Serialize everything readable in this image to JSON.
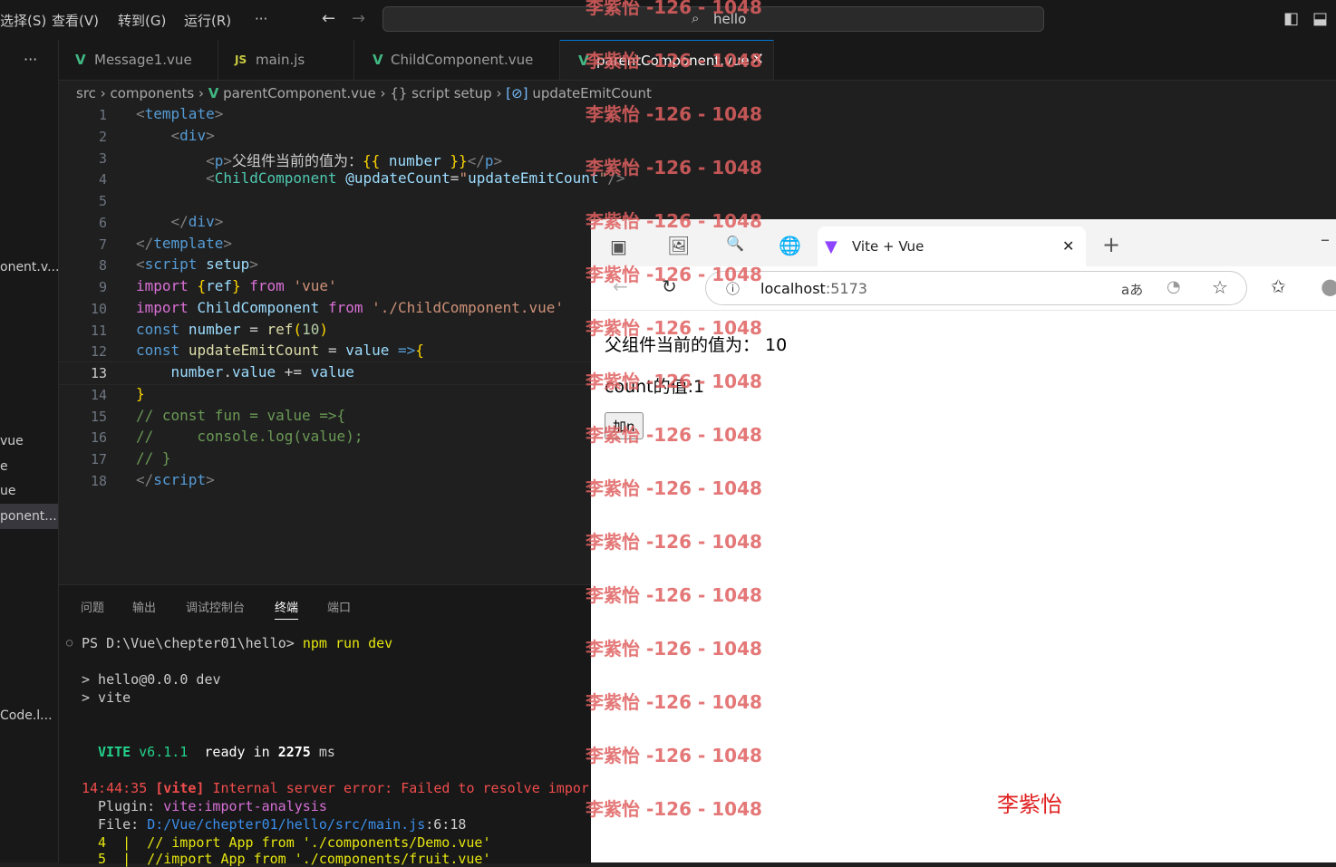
{
  "titlebar": {
    "menus": [
      "选择(S)",
      "查看(V)",
      "转到(G)",
      "运行(R)",
      "···"
    ],
    "search": "hello"
  },
  "sidebar": {
    "items": [
      "onent.v...",
      "vue",
      "e",
      "ue",
      "ponent....",
      "Code.l..."
    ]
  },
  "tabs": [
    {
      "label": "Message1.vue",
      "icon": "vue-icon"
    },
    {
      "label": "main.js",
      "icon": "js-icon"
    },
    {
      "label": "ChildComponent.vue",
      "icon": "vue-icon"
    },
    {
      "label": "parentComponent.vue",
      "icon": "vue-icon",
      "active": true
    }
  ],
  "breadcrumb": {
    "src": "src",
    "components": "components",
    "file": "parentComponent.vue",
    "script": "{} script setup",
    "symbol": "updateEmitCount"
  },
  "code": {
    "line_numbers": [
      "1",
      "2",
      "3",
      "4",
      "5",
      "6",
      "7",
      "8",
      "9",
      "10",
      "11",
      "12",
      "13",
      "14",
      "15",
      "16",
      "17",
      "18"
    ],
    "current_line": "13"
  },
  "panel": {
    "tabs": [
      "问题",
      "输出",
      "调试控制台",
      "终端",
      "端口"
    ],
    "active_tab": "终端",
    "terminal": {
      "prompt": "PS D:\\Vue\\chepter01\\hello>",
      "cmd": "npm run dev",
      "l1": "> hello@0.0.0 dev",
      "l2": "> vite",
      "vite": "VITE",
      "ver": "v6.1.1",
      "ready": "ready in",
      "ms_val": "2275",
      "ms": "ms",
      "time": "14:44:35",
      "vtag": "[vite]",
      "err": "Internal server error: Failed to resolve impor",
      "plugin_lbl": "Plugin:",
      "plugin": "vite:import-analysis",
      "file_lbl": "File:",
      "file": "D:/Vue/chepter01/hello/src/main.js",
      "file_pos": ":6:18",
      "c4": "4  |  // import App from './components/Demo.vue'",
      "c5": "5  |  //import App from './components/fruit.vue'"
    }
  },
  "browser": {
    "tab_title": "Vite + Vue",
    "url_host": "localhost",
    "url_port": ":5173",
    "read_aloud": "aあ",
    "page": {
      "p1": "父组件当前的值为：  10",
      "p2": "count的值:1",
      "button": "加n",
      "signature": "李紫怡"
    }
  },
  "watermark": "李紫怡 -126 - 1048"
}
